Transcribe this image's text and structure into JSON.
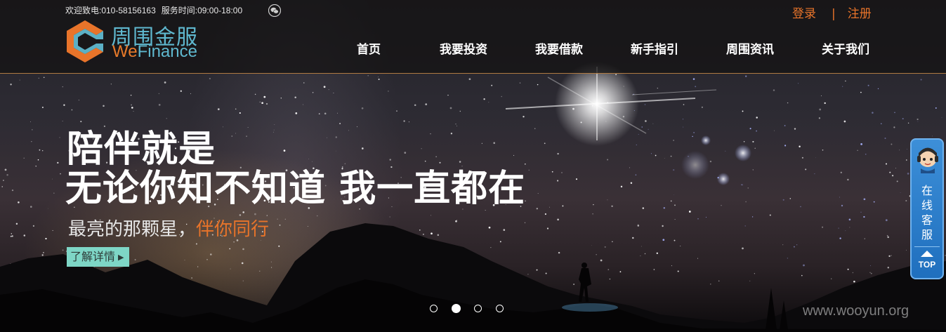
{
  "header": {
    "hotline": "欢迎致电:010-58156163",
    "hours": "服务时间:09:00-18:00",
    "logo_cn": "周围金服",
    "logo_en_we": "We",
    "logo_en_finance": "Finance",
    "login": "登录",
    "separator": "|",
    "register": "注册"
  },
  "nav": {
    "items": [
      {
        "label": "首页"
      },
      {
        "label": "我要投资"
      },
      {
        "label": "我要借款"
      },
      {
        "label": "新手指引"
      },
      {
        "label": "周围资讯"
      },
      {
        "label": "关于我们"
      }
    ]
  },
  "hero": {
    "headline1": "陪伴就是",
    "headline2": "无论你知不知道 我一直都在",
    "subline": "最亮的那颗星，",
    "subline_accent": "伴你同行",
    "more_label": "了解详情",
    "slides_count": 4,
    "active_slide": 2
  },
  "side_panel": {
    "service_text": "在线客服",
    "top_label": "TOP"
  },
  "watermark": "www.wooyun.org",
  "colors": {
    "accent_orange": "#e8742a",
    "logo_blue": "#5fb8cf",
    "button_teal": "#7ed6c6",
    "side_blue": "#2a7fcf"
  }
}
